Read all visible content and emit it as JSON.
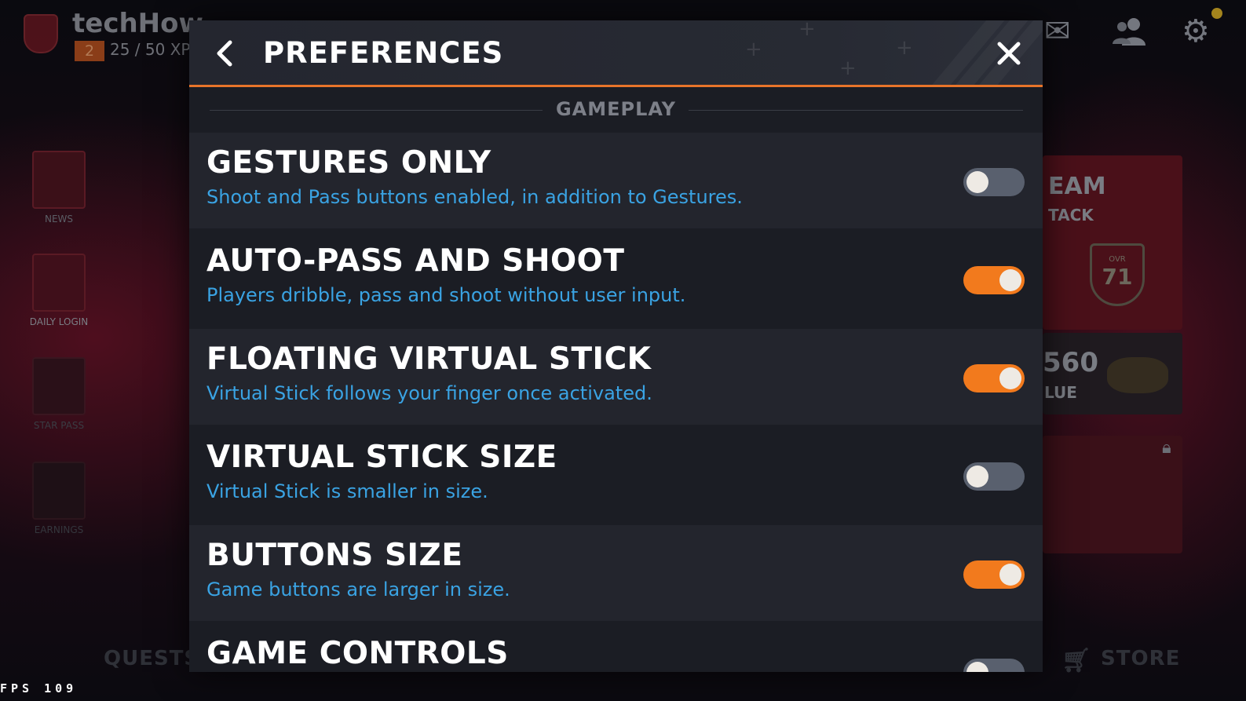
{
  "background": {
    "user_name": "techHow",
    "level": "2",
    "xp": "25 / 50 XP",
    "sidebar": [
      {
        "label": "NEWS"
      },
      {
        "label": "DAILY LOGIN"
      },
      {
        "label": "STAR PASS"
      },
      {
        "label": "EARNINGS"
      }
    ],
    "team_card": {
      "line1": "EAM",
      "line2": "TACK",
      "ovr_label": "OVR",
      "ovr": "71"
    },
    "value_card": {
      "amount": "560",
      "label": "LUE"
    },
    "bottom_nav": {
      "quests": "QUESTS",
      "store": "STORE"
    },
    "fps": "FPS 109"
  },
  "modal": {
    "title": "PREFERENCES",
    "back_icon": "chevron-left-icon",
    "close_icon": "close-icon",
    "section": "GAMEPLAY",
    "accent_color": "#e8742a",
    "toggle_on_color": "#f27a1d",
    "toggle_off_color": "#59606e",
    "description_color": "#3aa3e3",
    "settings": [
      {
        "title": "GESTURES ONLY",
        "description": "Shoot and Pass buttons enabled, in addition to Gestures.",
        "enabled": false
      },
      {
        "title": "AUTO-PASS AND SHOOT",
        "description": "Players dribble, pass and shoot without user input.",
        "enabled": true
      },
      {
        "title": "FLOATING VIRTUAL STICK",
        "description": "Virtual Stick follows your finger once activated.",
        "enabled": true
      },
      {
        "title": "VIRTUAL STICK SIZE",
        "description": "Virtual Stick is smaller in size.",
        "enabled": false
      },
      {
        "title": "BUTTONS SIZE",
        "description": "Game buttons are larger in size.",
        "enabled": true
      },
      {
        "title": "GAME CONTROLS",
        "description": "",
        "enabled": false
      }
    ]
  }
}
